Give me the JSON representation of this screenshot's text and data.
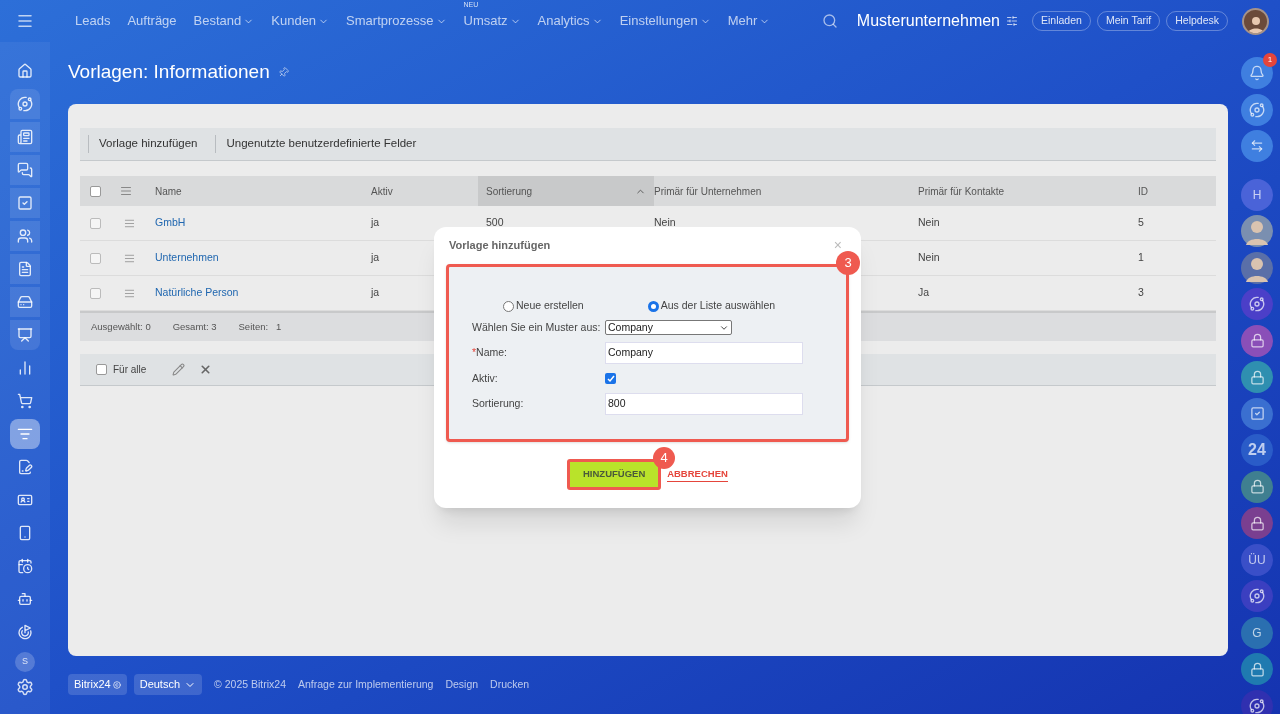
{
  "top_nav": {
    "items": [
      {
        "label": "Leads",
        "dropdown": false
      },
      {
        "label": "Aufträge",
        "dropdown": false
      },
      {
        "label": "Bestand",
        "dropdown": true
      },
      {
        "label": "Kunden",
        "dropdown": true
      },
      {
        "label": "Smartprozesse",
        "dropdown": true
      },
      {
        "label": "Umsatz",
        "dropdown": true,
        "badge": "NEU"
      },
      {
        "label": "Analytics",
        "dropdown": true
      },
      {
        "label": "Einstellungen",
        "dropdown": true
      },
      {
        "label": "Mehr",
        "dropdown": true
      }
    ],
    "company": "Musterunternehmen",
    "buttons": [
      "Einladen",
      "Mein Tarif",
      "Helpdesk"
    ]
  },
  "left_sidebar": [
    {
      "kind": "icon",
      "selected": false
    },
    {
      "kind": "icon",
      "selected": false
    },
    {
      "kind": "icon",
      "selected": false
    },
    {
      "kind": "icon",
      "selected": false
    },
    {
      "kind": "icon",
      "selected": false
    },
    {
      "kind": "icon",
      "selected": false
    },
    {
      "kind": "icon",
      "selected": false
    },
    {
      "kind": "icon",
      "selected": false
    },
    {
      "kind": "icon",
      "selected": false
    },
    {
      "kind": "icon",
      "selected": false
    },
    {
      "kind": "icon",
      "selected": false
    },
    {
      "kind": "icon",
      "selected": true
    },
    {
      "kind": "icon",
      "selected": false
    },
    {
      "kind": "icon",
      "selected": false
    },
    {
      "kind": "icon",
      "selected": false
    },
    {
      "kind": "icon",
      "selected": false
    },
    {
      "kind": "icon",
      "selected": false
    },
    {
      "kind": "icon",
      "selected": false
    },
    {
      "kind": "avatar",
      "label": "S"
    }
  ],
  "page_title": "Vorlagen: Informationen",
  "toolbar": [
    "Vorlage hinzufügen",
    "Ungenutzte benutzerdefinierte Felder"
  ],
  "table": {
    "select_all_checked": false,
    "columns": [
      {
        "label": "Name",
        "sorted": false
      },
      {
        "label": "Aktiv",
        "sorted": false
      },
      {
        "label": "Sortierung",
        "sorted": true
      },
      {
        "label": "Primär für Unternehmen",
        "sorted": false
      },
      {
        "label": "Primär für Kontakte",
        "sorted": false
      },
      {
        "label": "ID",
        "sorted": false
      }
    ],
    "rows": [
      {
        "checked": false,
        "cells": [
          "GmbH",
          "ja",
          "500",
          "Nein",
          "Nein",
          "5"
        ]
      },
      {
        "checked": false,
        "cells": [
          "Unternehmen",
          "ja",
          null,
          null,
          "Nein",
          "1"
        ]
      },
      {
        "checked": false,
        "cells": [
          "Natürliche Person",
          "ja",
          null,
          null,
          "Ja",
          "3"
        ]
      }
    ],
    "summary": [
      "Ausgewählt: 0",
      "Gesamt: 3",
      "Seiten:",
      "1"
    ]
  },
  "bulk_actions": {
    "label": "Für alle",
    "checked": false
  },
  "dialog": {
    "title": "Vorlage hinzufügen",
    "close": "×",
    "callout": "3",
    "radios": [
      {
        "label": "Neue erstellen",
        "selected": false
      },
      {
        "label": "Aus der Liste auswählen",
        "selected": true
      }
    ],
    "fields": [
      {
        "kind": "select",
        "label": "Wählen Sie ein Muster aus:",
        "value": "Company"
      },
      {
        "kind": "text",
        "required_mark": "*",
        "label": "Name:",
        "value": "Company"
      },
      {
        "kind": "checkbox",
        "label": "Aktiv:",
        "checked": true
      },
      {
        "kind": "text",
        "label": "Sortierung:",
        "value": "800"
      }
    ],
    "submit": {
      "label": "HINZUFÜGEN",
      "callout": "4"
    },
    "cancel": "ABBRECHEN"
  },
  "right_sidebar": [
    {
      "kind": "bell",
      "badge": "1",
      "color": "#3f7fe0"
    },
    {
      "kind": "icon",
      "color": "#3f7fe0"
    },
    {
      "kind": "chat",
      "color": "#3f7fe0"
    },
    {
      "kind": "letter",
      "label": "H",
      "color": "#4a63d8"
    },
    {
      "kind": "avatar",
      "color": "#7a8fb0"
    },
    {
      "kind": "avatar",
      "color": "#5a6fa8"
    },
    {
      "kind": "icon",
      "color": "#4b3fc8"
    },
    {
      "kind": "lock",
      "color": "#8a4fb8"
    },
    {
      "kind": "lock",
      "color": "#2f8fb0"
    },
    {
      "kind": "check",
      "color": "#3a6fd0"
    },
    {
      "kind": "number",
      "label": "24",
      "color": "#2a5cc8"
    },
    {
      "kind": "lock",
      "color": "#3f7f90"
    },
    {
      "kind": "lock",
      "color": "#7a3f90"
    },
    {
      "kind": "letter",
      "label": "ÜU",
      "color": "#3a4fc8"
    },
    {
      "kind": "icon",
      "color": "#3b3fc0"
    },
    {
      "kind": "letter",
      "label": "G",
      "color": "#2a6fb0"
    },
    {
      "kind": "lock",
      "color": "#1f7ab0"
    },
    {
      "kind": "icon",
      "color": "#3030b0"
    }
  ],
  "footer": {
    "brand": "Bitrix24",
    "language": "Deutsch",
    "links": [
      "© 2025 Bitrix24",
      "Anfrage zur Implementierung",
      "Design",
      "Drucken"
    ]
  }
}
